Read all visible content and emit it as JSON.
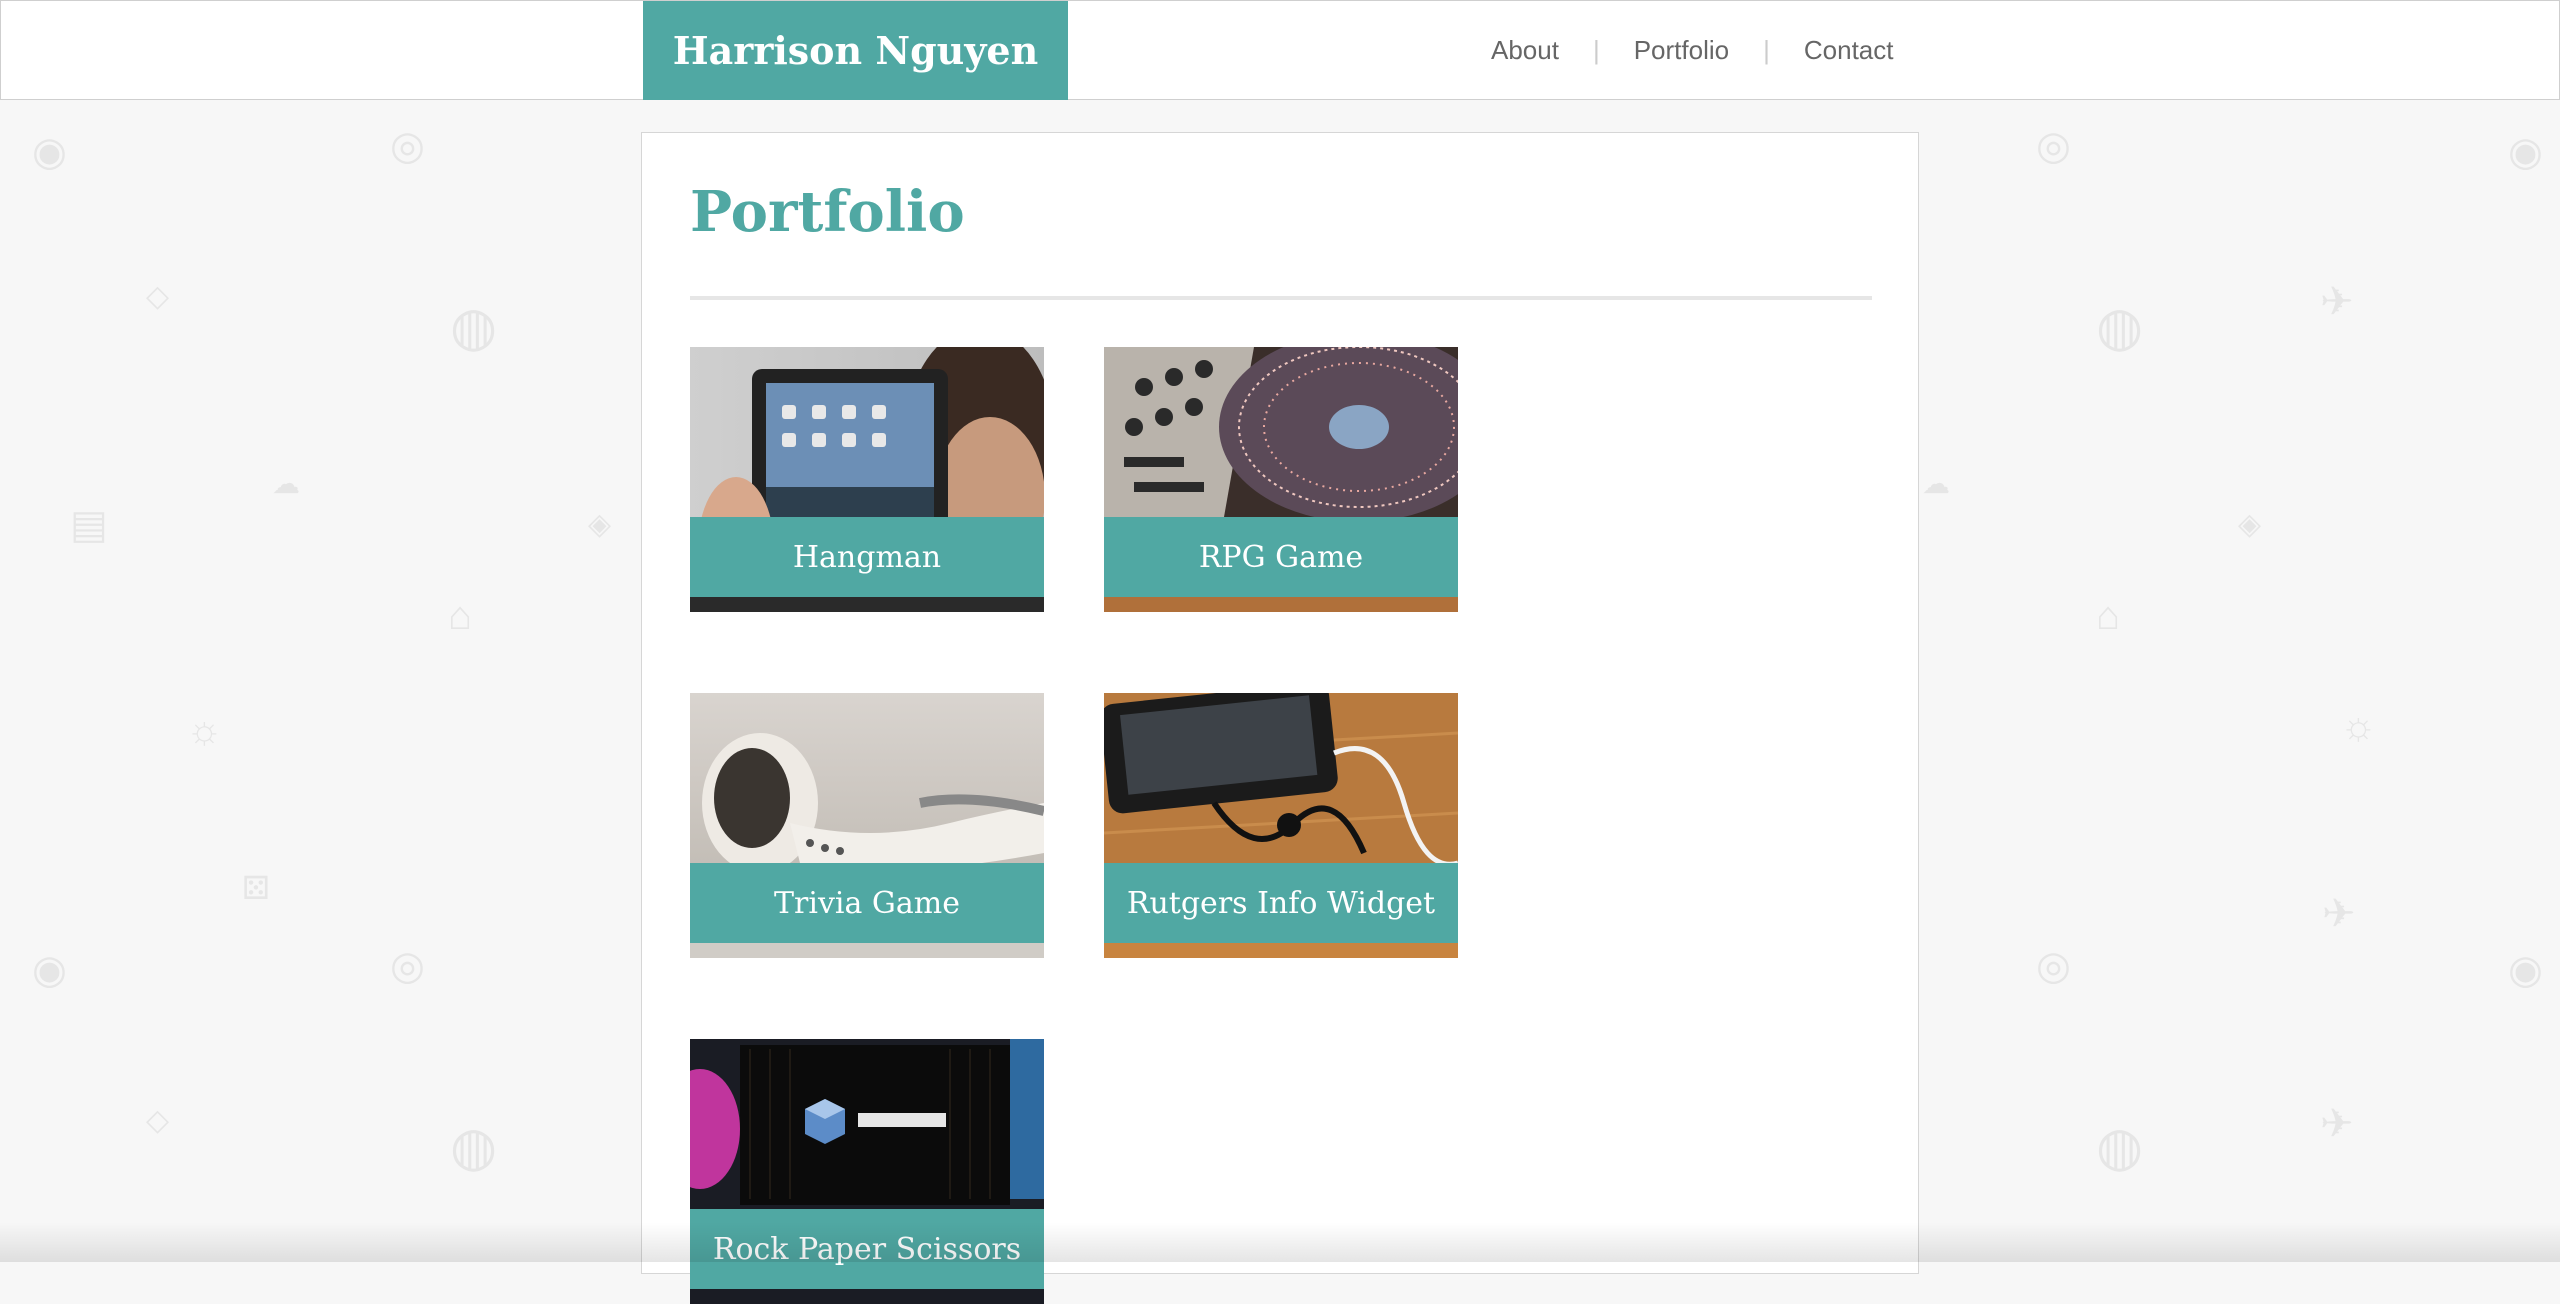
{
  "site": {
    "brand": "Harrison Nguyen",
    "nav": [
      {
        "label": "About"
      },
      {
        "label": "Portfolio"
      },
      {
        "label": "Contact"
      }
    ],
    "separator": "|"
  },
  "page": {
    "title": "Portfolio"
  },
  "projects": [
    {
      "label": "Hangman",
      "image": "tablet-photo"
    },
    {
      "label": "RPG Game",
      "image": "turntable-photo"
    },
    {
      "label": "Trivia Game",
      "image": "earbuds-photo"
    },
    {
      "label": "Rutgers Info Widget",
      "image": "phone-earphones-photo"
    },
    {
      "label": "Rock Paper Scissors",
      "image": "led-tv-photo"
    }
  ],
  "theme": {
    "accent": "#50a8a3",
    "nav_text": "#666666",
    "background": "#f7f7f7"
  }
}
